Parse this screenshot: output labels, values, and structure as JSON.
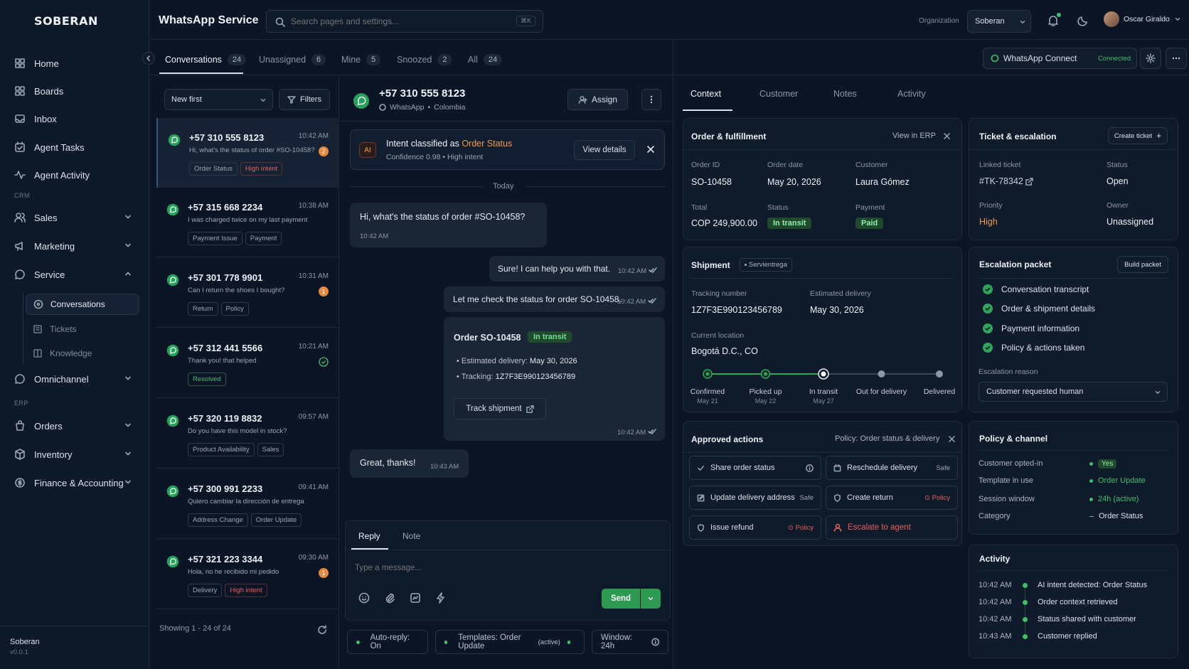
{
  "brand": "SOBERAN",
  "sidebar": {
    "home": "Home",
    "boards": "Boards",
    "inbox": "Inbox",
    "agent_tasks": "Agent Tasks",
    "agent_activity": "Agent Activity",
    "crm": "CRM",
    "sales": "Sales",
    "marketing": "Marketing",
    "service": "Service",
    "conversations": "Conversations",
    "tickets": "Tickets",
    "knowledge": "Knowledge",
    "omnichannel": "Omnichannel",
    "erp": "ERP",
    "orders": "Orders",
    "inventory": "Inventory",
    "finance": "Finance & Accounting",
    "org_name": "Soberan",
    "version": "v0.0.1"
  },
  "header": {
    "title": "WhatsApp Service",
    "search_placeholder": "Search pages and settings...",
    "shortcut": "⌘K",
    "org_label": "Organization",
    "org_value": "Soberan",
    "user": "Oscar Giraldo"
  },
  "tabs": [
    {
      "label": "Conversations",
      "count": "24"
    },
    {
      "label": "Unassigned",
      "count": "6"
    },
    {
      "label": "Mine",
      "count": "5"
    },
    {
      "label": "Snoozed",
      "count": "2"
    },
    {
      "label": "All",
      "count": "24"
    }
  ],
  "connect": {
    "label": "WhatsApp Connect",
    "status": "Connected"
  },
  "list": {
    "sort": "New first",
    "filters": "Filters",
    "footer": "Showing 1 - 24 of 24",
    "items": [
      {
        "phone": "+57 310 555 8123",
        "time": "10:42 AM",
        "msg": "Hi, what's the status of order #SO-10458?",
        "tags": [
          "Order Status",
          "High intent"
        ],
        "badge": "2"
      },
      {
        "phone": "+57 315 668 2234",
        "time": "10:38 AM",
        "msg": "I was charged twice on my last payment",
        "tags": [
          "Payment Issue",
          "Payment"
        ]
      },
      {
        "phone": "+57 301 778 9901",
        "time": "10:31 AM",
        "msg": "Can I return the shoes I bought?",
        "tags": [
          "Return",
          "Policy"
        ],
        "badge": "1"
      },
      {
        "phone": "+57 312 441 5566",
        "time": "10:21 AM",
        "msg": "Thank you! that helped",
        "tags": [
          "Resolved"
        ]
      },
      {
        "phone": "+57 320 119 8832",
        "time": "09:57 AM",
        "msg": "Do you have this model in stock?",
        "tags": [
          "Product Availability",
          "Sales"
        ]
      },
      {
        "phone": "+57 300 991 2233",
        "time": "09:41 AM",
        "msg": "Quiero cambiar la dirección de entrega",
        "tags": [
          "Address Change",
          "Order Update"
        ]
      },
      {
        "phone": "+57 321 223 3344",
        "time": "09:30 AM",
        "msg": "Hola, no he recibido mi pedido",
        "tags": [
          "Delivery",
          "High intent"
        ],
        "badge": "1"
      }
    ]
  },
  "chat": {
    "phone": "+57 310 555 8123",
    "channel": "WhatsApp",
    "country": "Colombia",
    "assign": "Assign",
    "intent_prefix": "Intent classified as",
    "intent": "Order Status",
    "confidence": "Confidence 0.98",
    "intent_level": "High intent",
    "view_details": "View details",
    "ai": "AI",
    "today": "Today",
    "m1": "Hi, what's the status of order #SO-10458?",
    "m1_time": "10:42 AM",
    "m2": "Sure! I can help you with that.",
    "m2_time": "10:42 AM",
    "m3": "Let me check the status for order SO-10458.",
    "m3_time": "10:42 AM",
    "order_card": {
      "title": "Order SO-10458",
      "status": "In transit",
      "est_label": "Estimated delivery:",
      "est": "May 30, 2026",
      "track_label": "Tracking:",
      "tracking": "1Z7F3E990123456789",
      "button": "Track shipment",
      "time": "10:42 AM"
    },
    "m4": "Great, thanks!",
    "m4_time": "10:43 AM",
    "reply_tab": "Reply",
    "note_tab": "Note",
    "input_placeholder": "Type a message...",
    "send": "Send",
    "autoreply": "Auto-reply: On",
    "templates": "Templates: Order Update",
    "templates_active": "(active)",
    "window": "Window: 24h"
  },
  "context": {
    "tabs": [
      "Context",
      "Customer",
      "Notes",
      "Activity"
    ],
    "order": {
      "title": "Order & fulfillment",
      "view_erp": "View in ERP",
      "order_id_l": "Order ID",
      "order_id": "SO-10458",
      "date_l": "Order date",
      "date": "May 20, 2026",
      "cust_l": "Customer",
      "cust": "Laura Gómez",
      "total_l": "Total",
      "total": "COP 249,900.00",
      "status_l": "Status",
      "status": "In transit",
      "pay_l": "Payment",
      "pay": "Paid"
    },
    "shipment": {
      "title": "Shipment",
      "carrier": "Servientrega",
      "track_l": "Tracking number",
      "track": "1Z7F3E990123456789",
      "est_l": "Estimated delivery",
      "est": "May 30, 2026",
      "loc_l": "Current location",
      "loc": "Bogotá D.C., CO",
      "steps": [
        {
          "label": "Confirmed",
          "date": "May 21"
        },
        {
          "label": "Picked up",
          "date": "May 22"
        },
        {
          "label": "In transit",
          "date": "May 27"
        },
        {
          "label": "Out for delivery",
          "date": ""
        },
        {
          "label": "Delivered",
          "date": ""
        }
      ],
      "progress": 0.5
    },
    "actions": {
      "title": "Approved actions",
      "policy": "Policy: Order status & delivery",
      "items": [
        {
          "label": "Share order status",
          "right": ""
        },
        {
          "label": "Reschedule delivery",
          "right": "Safe"
        },
        {
          "label": "Update delivery address",
          "right": "Safe"
        },
        {
          "label": "Create return",
          "right": "Policy"
        },
        {
          "label": "Issue refund",
          "right": "Policy"
        },
        {
          "label": "Escalate to agent",
          "right": ""
        }
      ]
    },
    "ticket": {
      "title": "Ticket & escalation",
      "create": "Create ticket",
      "linked_l": "Linked ticket",
      "linked": "#TK-78342",
      "status_l": "Status",
      "status": "Open",
      "priority_l": "Priority",
      "priority": "High",
      "owner_l": "Owner",
      "owner": "Unassigned"
    },
    "packet": {
      "title": "Escalation packet",
      "build": "Build packet",
      "items": [
        "Conversation transcript",
        "Order & shipment details",
        "Payment information",
        "Policy & actions taken"
      ],
      "reason_l": "Escalation reason",
      "reason": "Customer requested human"
    },
    "policy": {
      "title": "Policy & channel",
      "rows": [
        {
          "k": "Customer opted-in",
          "v": "Yes"
        },
        {
          "k": "Template in use",
          "v": "Order Update"
        },
        {
          "k": "Session window",
          "v": "24h (active)"
        },
        {
          "k": "Category",
          "v": "Order Status"
        }
      ]
    },
    "activity": {
      "title": "Activity",
      "rows": [
        {
          "t": "10:42 AM",
          "e": "AI intent detected: Order Status"
        },
        {
          "t": "10:42 AM",
          "e": "Order context retrieved"
        },
        {
          "t": "10:42 AM",
          "e": "Status shared with customer"
        },
        {
          "t": "10:43 AM",
          "e": "Customer replied"
        }
      ]
    }
  },
  "colors": {
    "accent_green": "#3fbf6a",
    "orange": "#f09a48",
    "red": "#e4605a",
    "bg": "#0b1525"
  }
}
